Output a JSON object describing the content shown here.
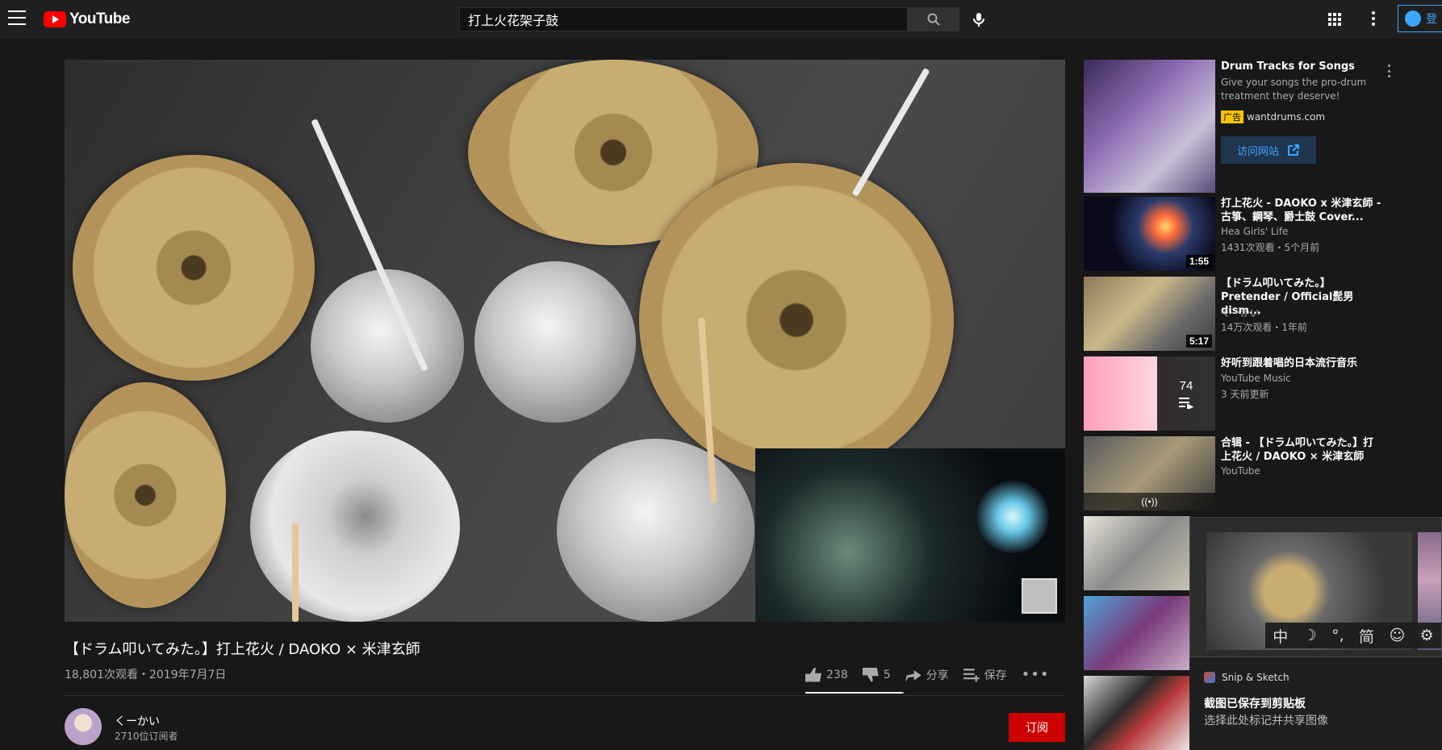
{
  "header": {
    "logo_text": "YouTube",
    "search_value": "打上火花架子鼓",
    "signin_label": "登"
  },
  "video": {
    "title": "【ドラム叩いてみた。】打上花火 / DAOKO × 米津玄師",
    "meta": "18,801次观看・2019年7月7日",
    "likes": "238",
    "dislikes": "5",
    "share_label": "分享",
    "save_label": "保存",
    "more_label": "•••",
    "like_ratio": 0.98
  },
  "channel": {
    "name": "くーかい",
    "subscribers": "2710位订阅者",
    "subscribe_label": "订阅"
  },
  "sidebar": {
    "ad": {
      "title": "Drum Tracks for Songs",
      "desc": "Give your songs the pro-drum treatment they deserve!",
      "badge": "广告",
      "domain": "wantdrums.com",
      "visit_label": "访问网站"
    },
    "items": [
      {
        "title": "打上花火 - DAOKO x 米津玄師 - 古箏、鋼琴、爵士鼓 Cover...",
        "channel": "Hea Girls' Life",
        "meta": "1431次观看・5个月前",
        "duration": "1:55"
      },
      {
        "title": "【ドラム叩いてみた。】Pretender / Official髭男dism...",
        "channel": "くーかい",
        "meta": "14万次观看・1年前",
        "duration": "5:17"
      },
      {
        "title": "好听到跟着唱的日本流行音乐",
        "channel": "YouTube Music",
        "meta": "3 天前更新",
        "count": "74"
      },
      {
        "title": "合辑 - 【ドラム叩いてみた。】打上花火 / DAOKO × 米津玄師",
        "channel": "YouTube",
        "meta": ""
      }
    ]
  },
  "ime": {
    "items": [
      "中",
      "☽",
      "°,",
      "简",
      "☺",
      "⚙"
    ]
  },
  "toast": {
    "app": "Snip & Sketch",
    "title": "截图已保存到剪贴板",
    "body": "选择此处标记并共享图像"
  },
  "colors": {
    "background": "#181818",
    "topbar": "#202020",
    "accent_red": "#cc0000",
    "link_blue": "#3ea6ff"
  }
}
